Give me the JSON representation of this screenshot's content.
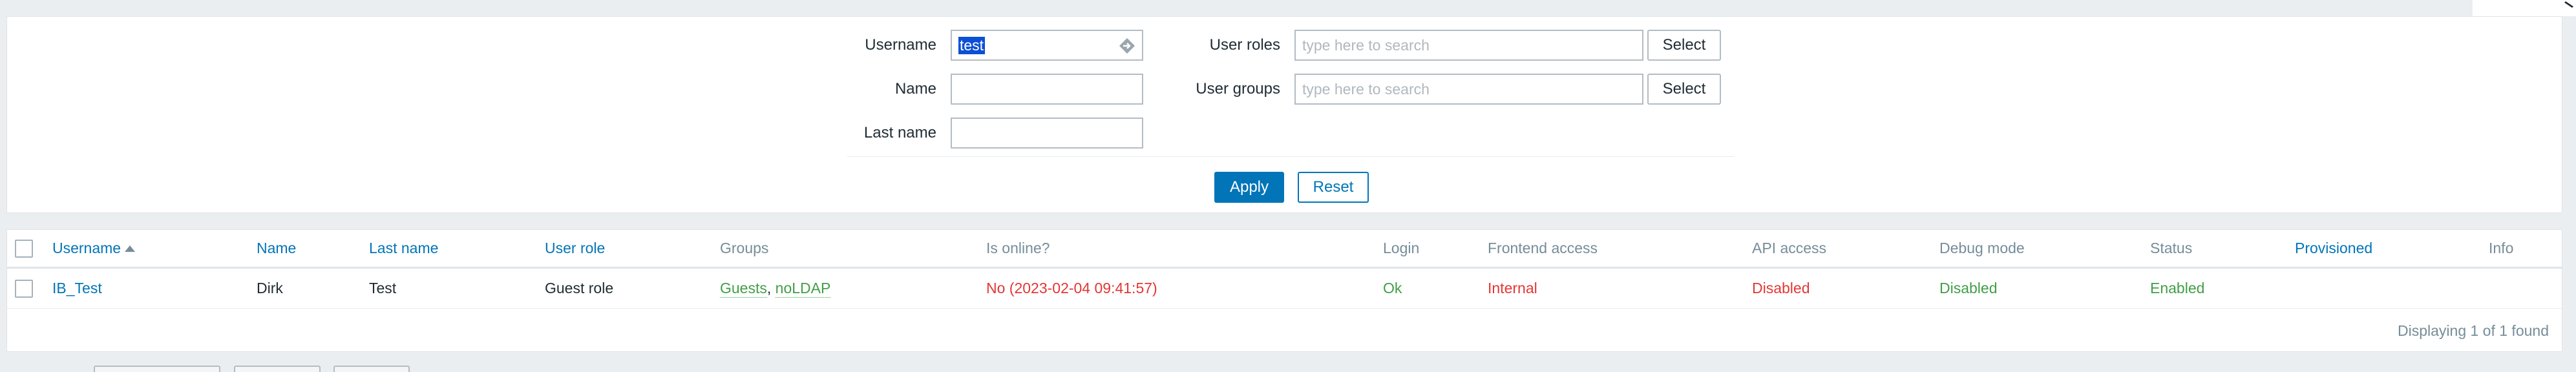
{
  "filter": {
    "username_label": "Username",
    "username_value": "test",
    "name_label": "Name",
    "name_value": "",
    "lastname_label": "Last name",
    "lastname_value": "",
    "user_roles_label": "User roles",
    "user_roles_placeholder": "type here to search",
    "user_groups_label": "User groups",
    "user_groups_placeholder": "type here to search",
    "select_label": "Select",
    "apply_label": "Apply",
    "reset_label": "Reset"
  },
  "table": {
    "headers": {
      "username": "Username",
      "name": "Name",
      "last_name": "Last name",
      "user_role": "User role",
      "groups": "Groups",
      "is_online": "Is online?",
      "login": "Login",
      "frontend_access": "Frontend access",
      "api_access": "API access",
      "debug_mode": "Debug mode",
      "status": "Status",
      "provisioned": "Provisioned",
      "info": "Info"
    },
    "rows": [
      {
        "username": "IB_Test",
        "name": "Dirk",
        "last_name": "Test",
        "user_role": "Guest role",
        "group_1": "Guests",
        "group_sep": ", ",
        "group_2": "noLDAP",
        "is_online": "No (2023-02-04 09:41:57)",
        "login": "Ok",
        "frontend_access": "Internal",
        "api_access": "Disabled",
        "debug_mode": "Disabled",
        "status": "Enabled",
        "provisioned": "",
        "info": ""
      }
    ],
    "footer": "Displaying 1 of 1 found"
  },
  "colors": {
    "link": "#0275b8",
    "green": "#429e47",
    "red": "#e33734",
    "muted": "#768d99",
    "background": "#ebeef0"
  },
  "icons": {
    "username_field_icon": "arrow-right-icon",
    "sort_icon": "sort-asc-icon"
  }
}
